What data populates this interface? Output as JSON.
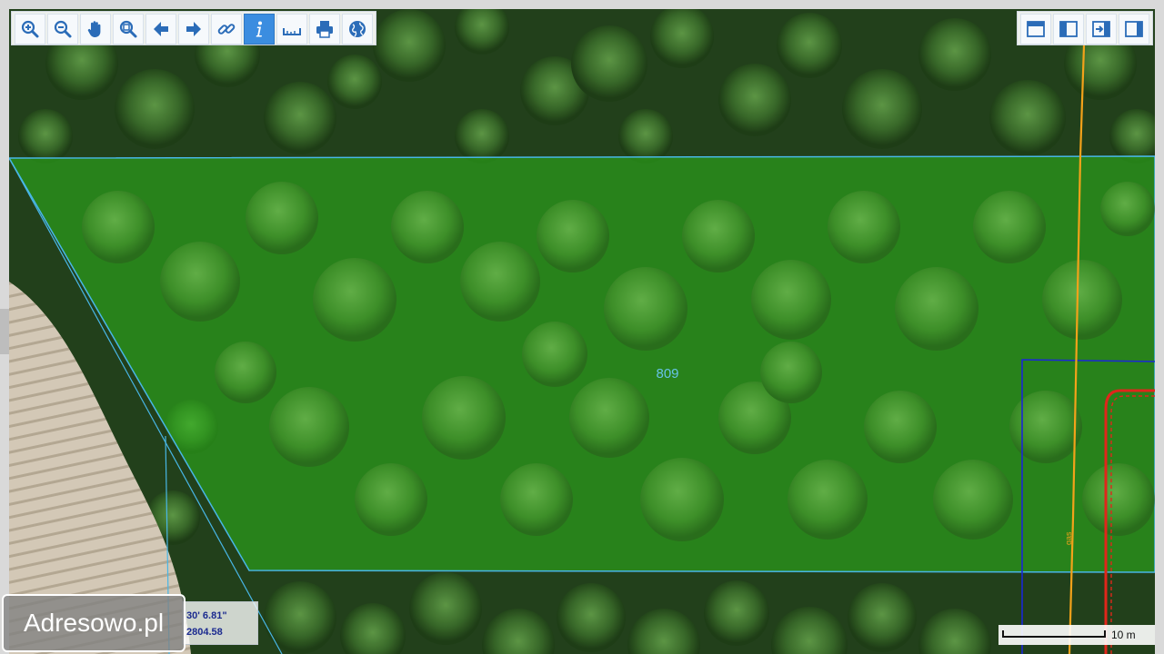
{
  "map": {
    "parcel_label": "809",
    "line_label": "gas",
    "colors": {
      "parcel_fill": "#2db81c",
      "parcel_border": "#48b6e6",
      "blue_boundary": "#1a27d6",
      "orange_line": "#f3a21a",
      "red_line": "#e0261b"
    }
  },
  "toolbar_left": {
    "buttons": [
      {
        "name": "zoom-in",
        "icon": "zoom-in-icon"
      },
      {
        "name": "zoom-out",
        "icon": "zoom-out-icon"
      },
      {
        "name": "pan",
        "icon": "hand-icon"
      },
      {
        "name": "zoom-extent",
        "icon": "zoom-extent-icon"
      },
      {
        "name": "previous-view",
        "icon": "arrow-left-icon"
      },
      {
        "name": "next-view",
        "icon": "arrow-right-icon"
      },
      {
        "name": "link",
        "icon": "link-icon"
      },
      {
        "name": "info",
        "icon": "info-icon",
        "active": true
      },
      {
        "name": "measure",
        "icon": "ruler-icon"
      },
      {
        "name": "print",
        "icon": "printer-icon"
      },
      {
        "name": "globe",
        "icon": "globe-icon"
      }
    ]
  },
  "toolbar_right": {
    "buttons": [
      {
        "name": "layout-top",
        "icon": "panel-top-icon"
      },
      {
        "name": "layout-left",
        "icon": "panel-left-icon"
      },
      {
        "name": "layout-export",
        "icon": "panel-arrow-icon"
      },
      {
        "name": "layout-right",
        "icon": "panel-right-icon"
      }
    ]
  },
  "coordinates": {
    "line1": "30' 6.81\"",
    "line2": "2804.58"
  },
  "brand": "Adresowo.pl",
  "scale": {
    "label": "10 m"
  }
}
